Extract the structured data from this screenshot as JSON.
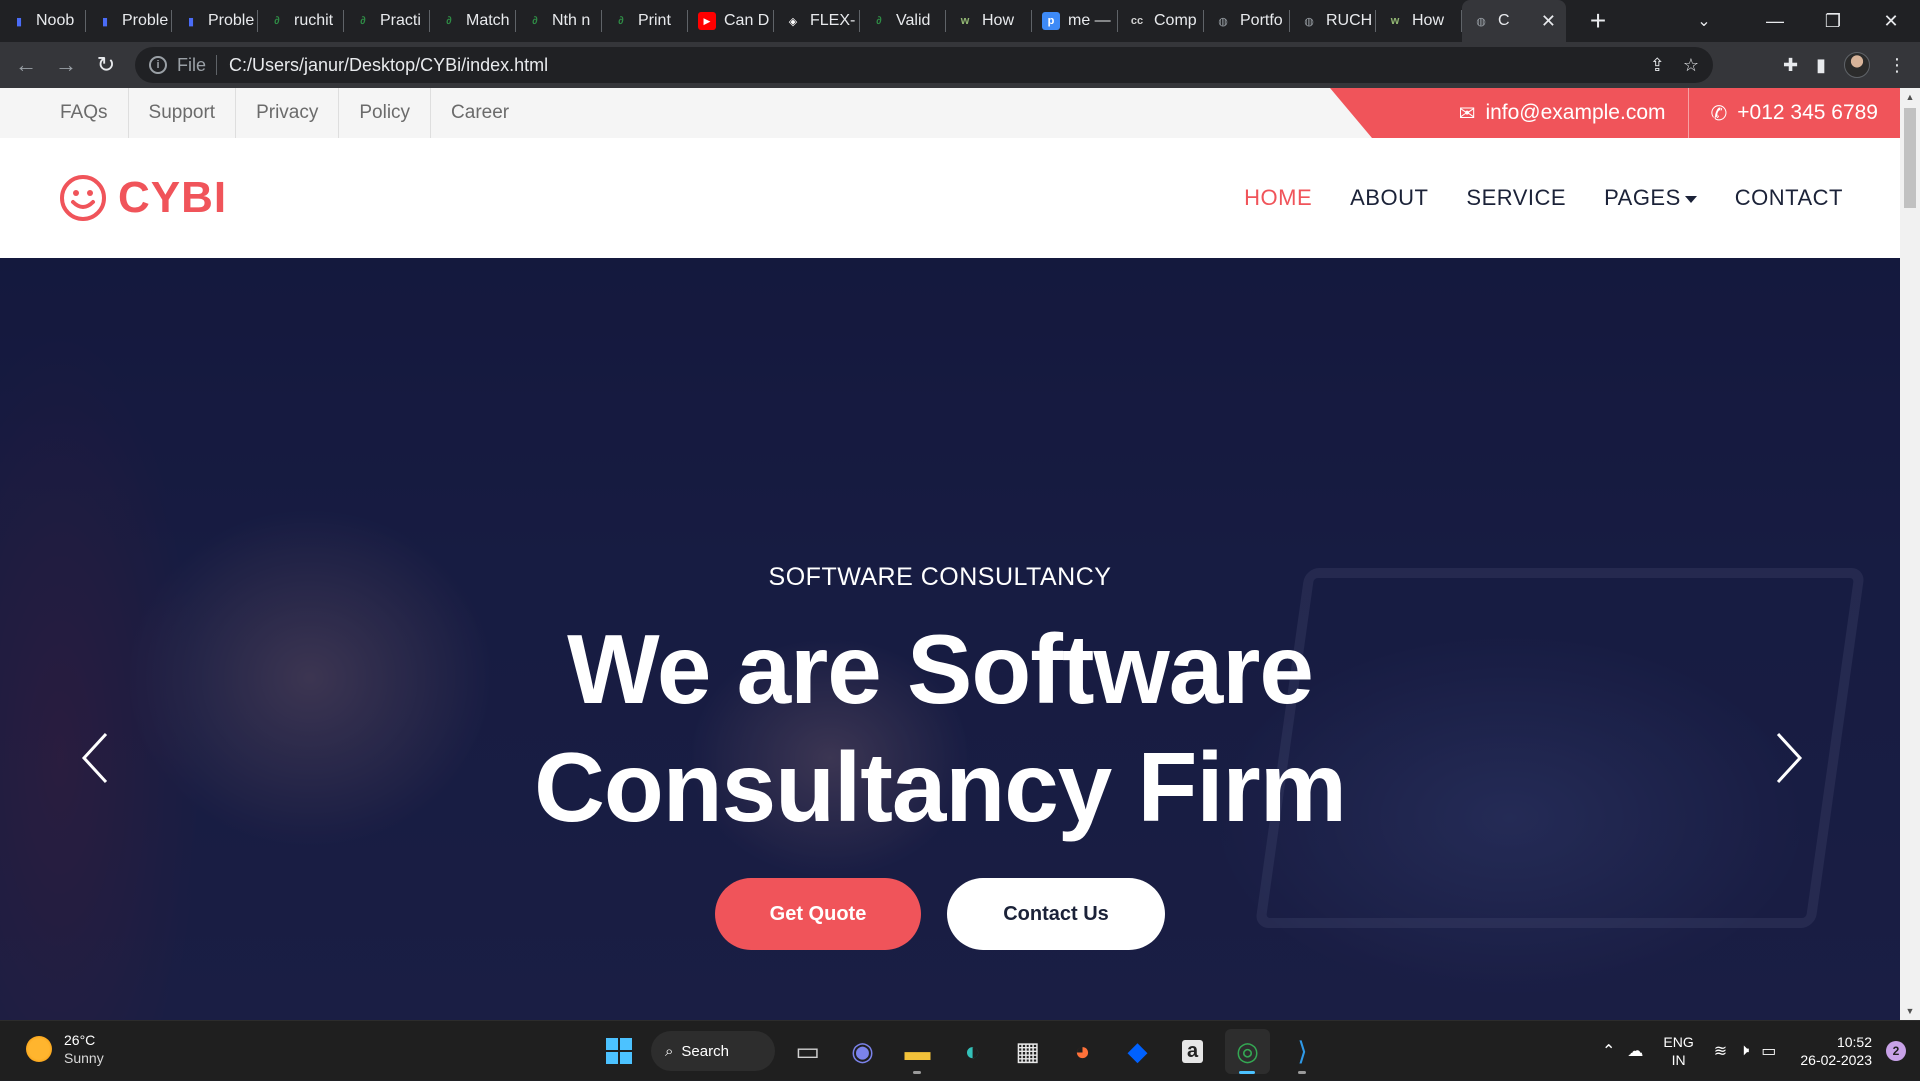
{
  "browser": {
    "tabs": [
      {
        "title": "Noob",
        "icon": "bars-icon",
        "color": "#4a6cf7"
      },
      {
        "title": "Proble",
        "icon": "bars-icon",
        "color": "#4a6cf7"
      },
      {
        "title": "Proble",
        "icon": "bars-icon",
        "color": "#4a6cf7"
      },
      {
        "title": "ruchit",
        "icon": "gfg-icon",
        "color": "#2f8d46"
      },
      {
        "title": "Practi",
        "icon": "gfg-icon",
        "color": "#2f8d46"
      },
      {
        "title": "Match",
        "icon": "gfg-icon",
        "color": "#2f8d46"
      },
      {
        "title": "Nth n",
        "icon": "gfg-icon",
        "color": "#2f8d46"
      },
      {
        "title": "Print",
        "icon": "gfg-icon",
        "color": "#2f8d46"
      },
      {
        "title": "Can D",
        "icon": "youtube-icon",
        "color": "#ff0000"
      },
      {
        "title": "FLEX-",
        "icon": "codepen-icon",
        "color": "#ffffff"
      },
      {
        "title": "Valid",
        "icon": "gfg-icon",
        "color": "#2f8d46"
      },
      {
        "title": "How",
        "icon": "wikihow-icon",
        "color": "#93b874"
      },
      {
        "title": "me —",
        "icon": "p-icon",
        "color": "#3d8af7"
      },
      {
        "title": "Comp",
        "icon": "cc-icon",
        "color": "#d0d0d0"
      },
      {
        "title": "Portfo",
        "icon": "globe-icon",
        "color": "#9aa0a6"
      },
      {
        "title": "RUCH",
        "icon": "globe-icon",
        "color": "#9aa0a6"
      },
      {
        "title": "How",
        "icon": "wikihow-icon",
        "color": "#93b874"
      },
      {
        "title": "C",
        "icon": "globe-icon",
        "color": "#9aa0a6",
        "active": true
      }
    ],
    "scheme_label": "File",
    "url": "C:/Users/janur/Desktop/CYBi/index.html"
  },
  "topbar": {
    "links": [
      "FAQs",
      "Support",
      "Privacy",
      "Policy",
      "Career"
    ],
    "email": "info@example.com",
    "phone": "+012 345 6789"
  },
  "nav": {
    "logo_text": "CYBI",
    "items": [
      {
        "label": "HOME",
        "active": true
      },
      {
        "label": "ABOUT"
      },
      {
        "label": "SERVICE"
      },
      {
        "label": "PAGES",
        "dropdown": true
      },
      {
        "label": "CONTACT"
      }
    ]
  },
  "hero": {
    "subtitle": "SOFTWARE CONSULTANCY",
    "title_line1": "We are Software",
    "title_line2": "Consultancy Firm",
    "primary_button": "Get Quote",
    "secondary_button": "Contact Us"
  },
  "colors": {
    "accent": "#f0545a",
    "dark_text": "#1b2238",
    "hero_overlay": "#101438"
  },
  "taskbar": {
    "weather_temp": "26°C",
    "weather_desc": "Sunny",
    "search_label": "Search",
    "apps": [
      "file-explorer-icon",
      "teams-icon",
      "folder-icon",
      "edge-icon",
      "store-icon",
      "firefox-icon",
      "dropbox-icon",
      "amazon-icon",
      "chrome-icon",
      "vscode-icon"
    ],
    "lang_line1": "ENG",
    "lang_line2": "IN",
    "time": "10:52",
    "date": "26-02-2023",
    "notifications": "2"
  }
}
